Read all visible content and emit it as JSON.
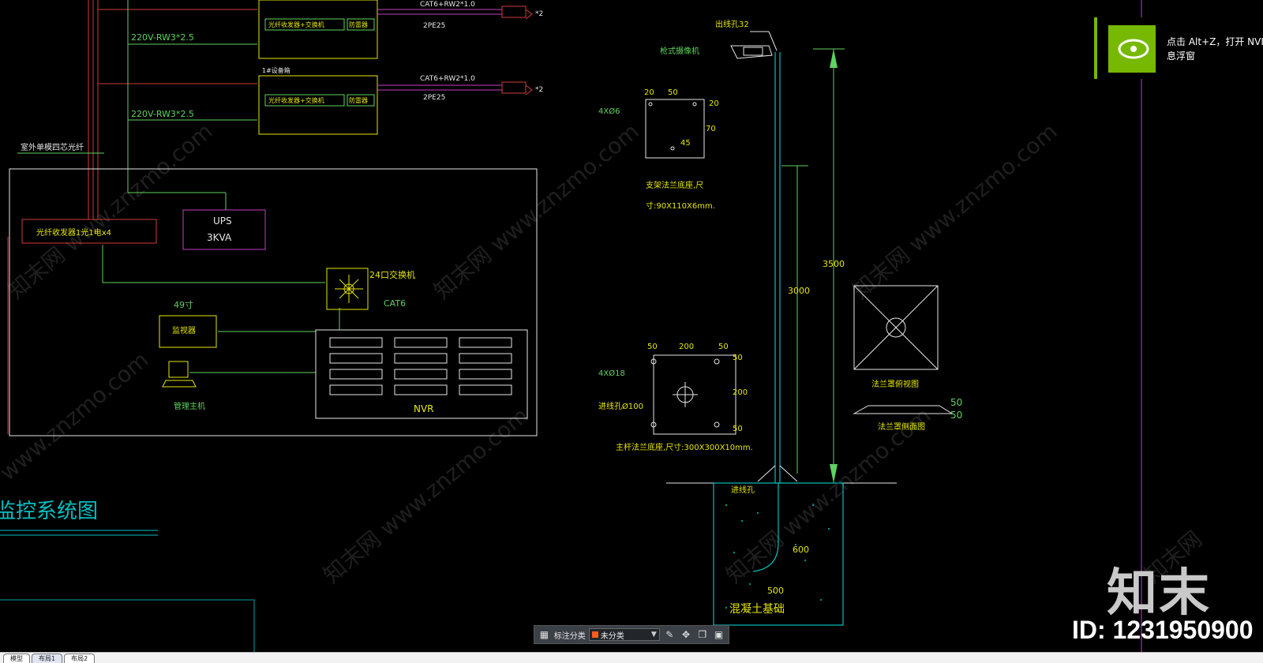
{
  "colors": {
    "background": "#000000",
    "cad_green": "#5fd25f",
    "cad_yellow": "#e6e600",
    "cad_cyan": "#00e5e5",
    "cad_red": "#d23a3a",
    "cad_magenta": "#c040c0",
    "nvidia_green": "#76b900"
  },
  "schematic": {
    "top_cable_1": "CAT6+RW2*1.0",
    "top_pe_1": "2PE25",
    "top_cam_count_1": "*2",
    "top_cable_2": "CAT6+RW2*1.0",
    "top_pe_2": "2PE25",
    "top_cam_count_2": "*2",
    "power_1": "220V-RW3*2.5",
    "power_2": "220V-RW3*2.5",
    "device_label": "1#设备箱",
    "box1_inner": "光纤收发器+交换机",
    "box1_side": "防雷器",
    "box2_inner": "光纤收发器+交换机",
    "box2_side": "防雷器",
    "fiber_label": "室外单模四芯光纤",
    "transceiver_label": "光纤收发器1光1电x4",
    "ups_line1": "UPS",
    "ups_line2": "3KVA",
    "switch_label": "24口交换机",
    "switch_cable": "CAT6",
    "monitor_size": "49寸",
    "monitor_label": "监视器",
    "host_label": "管理主机",
    "nvr_label": "NVR",
    "system_title": "监控系统图"
  },
  "pole_detail": {
    "outlet_label": "出线孔32",
    "camera_label": "枪式摄像机",
    "bracket_dims": [
      "20",
      "50",
      "20",
      "70",
      "45"
    ],
    "bracket_holes": "4XØ6",
    "bracket_title": "支架法兰底座,尺",
    "bracket_size": "寸:90X110X6mm.",
    "height_total": "3500",
    "height_pole": "3000",
    "flange_dims": [
      "50",
      "200",
      "50",
      "50",
      "200",
      "50"
    ],
    "flange_holes": "4XØ18",
    "flange_inlet": "进线孔Ø100",
    "flange_title": "主杆法兰底座,尺寸:300X300X10mm.",
    "cover_top_label": "法兰罩俯视图",
    "cover_side_label": "法兰罩侧面图",
    "cover_dims": [
      "50",
      "50"
    ],
    "inlet_label": "进线孔",
    "depth": "600",
    "width": "500",
    "foundation_label": "混凝土基础"
  },
  "nvidia_popup": {
    "line1": "点击 Alt+Z，打开 NVIDIA",
    "line2": "息浮窗"
  },
  "watermark": {
    "brand": "知末",
    "id": "ID: 1231950900"
  },
  "toolbar": {
    "label": "标注分类",
    "select_value": "未分类"
  },
  "tabs": [
    "模型",
    "布局1",
    "布局2"
  ]
}
